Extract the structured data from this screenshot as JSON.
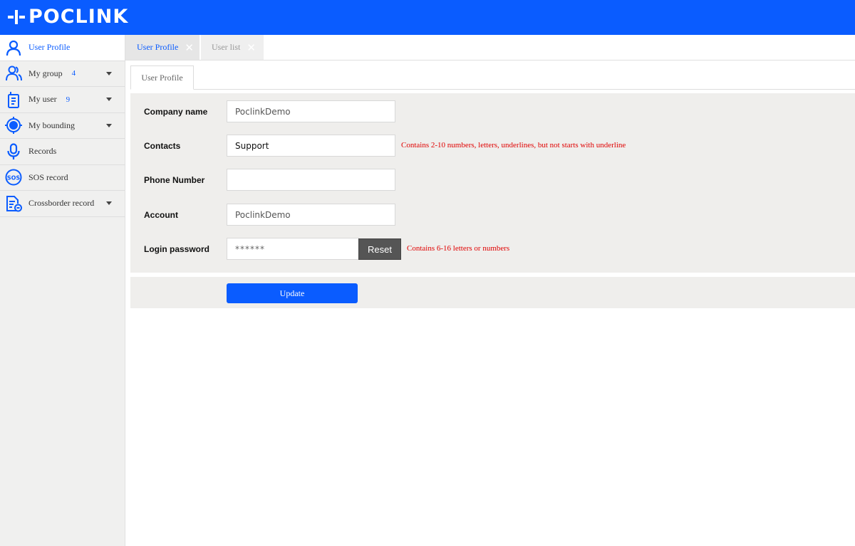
{
  "brand": {
    "name": "POCLINK",
    "color": "#0a5cff"
  },
  "sidebar": {
    "items": [
      {
        "label": "User Profile",
        "count": "",
        "icon": "user-icon"
      },
      {
        "label": "My group",
        "count": "4",
        "icon": "group-icon"
      },
      {
        "label": "My user",
        "count": "9",
        "icon": "radio-device-icon"
      },
      {
        "label": "My bounding",
        "count": "",
        "icon": "target-icon"
      },
      {
        "label": "Records",
        "count": "",
        "icon": "microphone-icon"
      },
      {
        "label": "SOS record",
        "count": "",
        "icon": "sos-icon"
      },
      {
        "label": "Crossborder record",
        "count": "",
        "icon": "document-icon"
      }
    ]
  },
  "tabs": [
    {
      "label": "User Profile",
      "active": true
    },
    {
      "label": "User list",
      "active": false
    }
  ],
  "subtab": {
    "label": "User Profile"
  },
  "form": {
    "company_name": {
      "label": "Company name",
      "value": "PoclinkDemo"
    },
    "contacts": {
      "label": "Contacts",
      "value": "Support",
      "hint": "Contains 2-10 numbers, letters, underlines, but not starts with underline"
    },
    "phone_number": {
      "label": "Phone Number",
      "value": ""
    },
    "account": {
      "label": "Account",
      "value": "PoclinkDemo"
    },
    "login_password": {
      "label": "Login password",
      "value": "******",
      "reset_label": "Reset",
      "hint": "Contains 6-16 letters or numbers"
    }
  },
  "actions": {
    "update_label": "Update"
  },
  "colors": {
    "accent": "#0a5cff",
    "error": "#e00000",
    "panel": "#efeeec"
  }
}
